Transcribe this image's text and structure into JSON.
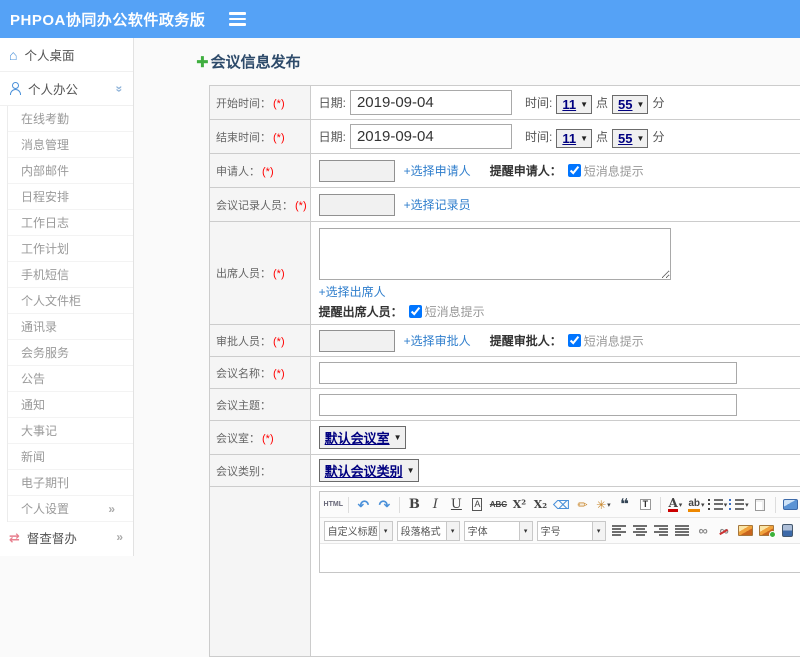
{
  "colors": {
    "header_bg": "#55a2f6",
    "link_blue": "#2f7ecc",
    "select_navy": "#000080",
    "required_red": "#ff0000",
    "title_navy": "#2d4a6a",
    "sidebar_icon_blue": "#4a90d9",
    "supervision_pink": "#e8808f"
  },
  "header": {
    "app_title": "PHPOA协同办公软件政务版"
  },
  "sidebar": {
    "desktop": {
      "label": "个人桌面"
    },
    "personal_office": {
      "label": "个人办公"
    },
    "submenu_items": [
      {
        "label": "在线考勤"
      },
      {
        "label": "消息管理"
      },
      {
        "label": "内部邮件"
      },
      {
        "label": "日程安排"
      },
      {
        "label": "工作日志"
      },
      {
        "label": "工作计划"
      },
      {
        "label": "手机短信"
      },
      {
        "label": "个人文件柜"
      },
      {
        "label": "通讯录"
      },
      {
        "label": "会务服务"
      },
      {
        "label": "公告"
      },
      {
        "label": "通知"
      },
      {
        "label": "大事记"
      },
      {
        "label": "新闻"
      },
      {
        "label": "电子期刊"
      },
      {
        "label": "个人设置",
        "chevron": "»"
      }
    ],
    "supervision": {
      "label": "督查督办",
      "chevron": "»"
    }
  },
  "main": {
    "page_title": "会议信息发布"
  },
  "form": {
    "labels": {
      "date": "日期:",
      "time": "时间:",
      "hour_unit": "点",
      "minute_unit": "分",
      "sms": "短消息提示"
    },
    "rows": {
      "start": {
        "label": "开始时间：",
        "req": "(*)",
        "date": "2019-09-04",
        "hour": "11",
        "minute": "55"
      },
      "end": {
        "label": "结束时间：",
        "req": "(*)",
        "date": "2019-09-04",
        "hour": "11",
        "minute": "55"
      },
      "applicant": {
        "label": "申请人：",
        "req": "(*)",
        "link": "+选择申请人",
        "remind_label": "提醒申请人：",
        "sms_checked": "checked"
      },
      "recorder": {
        "label": "会议记录人员：",
        "req": "(*)",
        "link": "+选择记录员"
      },
      "attendees": {
        "label": "出席人员：",
        "req": "(*)",
        "link": "+选择出席人",
        "remind_label": "提醒出席人员：",
        "sms_checked": "checked"
      },
      "approver": {
        "label": "审批人员：",
        "req": "(*)",
        "link": "+选择审批人",
        "remind_label": "提醒审批人：",
        "sms_checked": "checked"
      },
      "meeting_name": {
        "label": "会议名称：",
        "req": "(*)"
      },
      "meeting_topic": {
        "label": "会议主题：",
        "req": ""
      },
      "meeting_room": {
        "label": "会议室：",
        "req": "(*)",
        "selected": "默认会议室"
      },
      "meeting_category": {
        "label": "会议类别：",
        "req": "",
        "selected": "默认会议类别"
      }
    }
  },
  "editor": {
    "toolbar_row1": [
      {
        "name": "html-source-button",
        "glyph": "HTML",
        "cls": "g-html"
      },
      {
        "sep": true
      },
      {
        "name": "undo-button",
        "glyph": "↶",
        "cls": "g-blue g-big"
      },
      {
        "name": "redo-button",
        "glyph": "↷",
        "cls": "g-blue g-big"
      },
      {
        "sep": true
      },
      {
        "name": "bold-button",
        "glyph": "B",
        "cls": "g-b"
      },
      {
        "name": "italic-button",
        "glyph": "I",
        "cls": "g-i"
      },
      {
        "name": "underline-button",
        "glyph": "U",
        "cls": "g-u"
      },
      {
        "name": "bordered-text-button",
        "glyph": "A",
        "cls": "g-box"
      },
      {
        "name": "strikethrough-button",
        "glyph": "ABC",
        "cls": "g-strike"
      },
      {
        "name": "superscript-button",
        "glyph": "X²",
        "cls": "g-sup"
      },
      {
        "name": "subscript-button",
        "glyph": "X₂",
        "cls": "g-sup"
      },
      {
        "name": "eraser-button",
        "glyph": "⌫",
        "cls": "g-blue"
      },
      {
        "name": "format-brush-button",
        "glyph": "✏",
        "cls": "g-orange"
      },
      {
        "name": "autotypeset-button",
        "glyph": "✳",
        "cls": "g-orange",
        "dd": true
      },
      {
        "name": "blockquote-button",
        "glyph": "❝",
        "cls": "g-quote"
      },
      {
        "name": "paste-text-button",
        "glyph": "T",
        "cls": "g-paste"
      },
      {
        "sep": true
      },
      {
        "name": "font-color-button",
        "glyph": "A",
        "cls": "g-fontcolor",
        "dd": true
      },
      {
        "name": "highlight-color-button",
        "glyph": "ab",
        "cls": "g-highlight",
        "dd": true
      },
      {
        "name": "ordered-list-button",
        "icon": "bars-num",
        "dd": true
      },
      {
        "name": "unordered-list-button",
        "icon": "bars-dot",
        "dd": true
      },
      {
        "name": "new-page-button",
        "icon": "page"
      },
      {
        "sep": true
      },
      {
        "name": "fullscreen-button",
        "icon": "screen"
      }
    ],
    "combos": [
      {
        "name": "custom-title-select",
        "label": "自定义标题"
      },
      {
        "name": "paragraph-format-select",
        "label": "段落格式"
      },
      {
        "name": "font-family-select",
        "label": "字体"
      },
      {
        "name": "font-size-select",
        "label": "字号"
      }
    ],
    "toolbar_row2_icons": [
      {
        "name": "align-left-button",
        "icon": "bars-left"
      },
      {
        "name": "align-center-button",
        "icon": "bars-center"
      },
      {
        "name": "align-right-button",
        "icon": "bars-right"
      },
      {
        "name": "align-justify-button",
        "icon": "bars-justify"
      },
      {
        "name": "link-button",
        "glyph": "∞",
        "cls": "g-gray"
      },
      {
        "name": "unlink-button",
        "glyph": "∞",
        "cls": "g-gray g-unlk"
      },
      {
        "name": "image-button",
        "icon": "img"
      },
      {
        "name": "insert-picture-button",
        "icon": "img2"
      },
      {
        "name": "media-button",
        "icon": "media"
      },
      {
        "name": "insert-table-button",
        "icon": "table"
      }
    ]
  }
}
